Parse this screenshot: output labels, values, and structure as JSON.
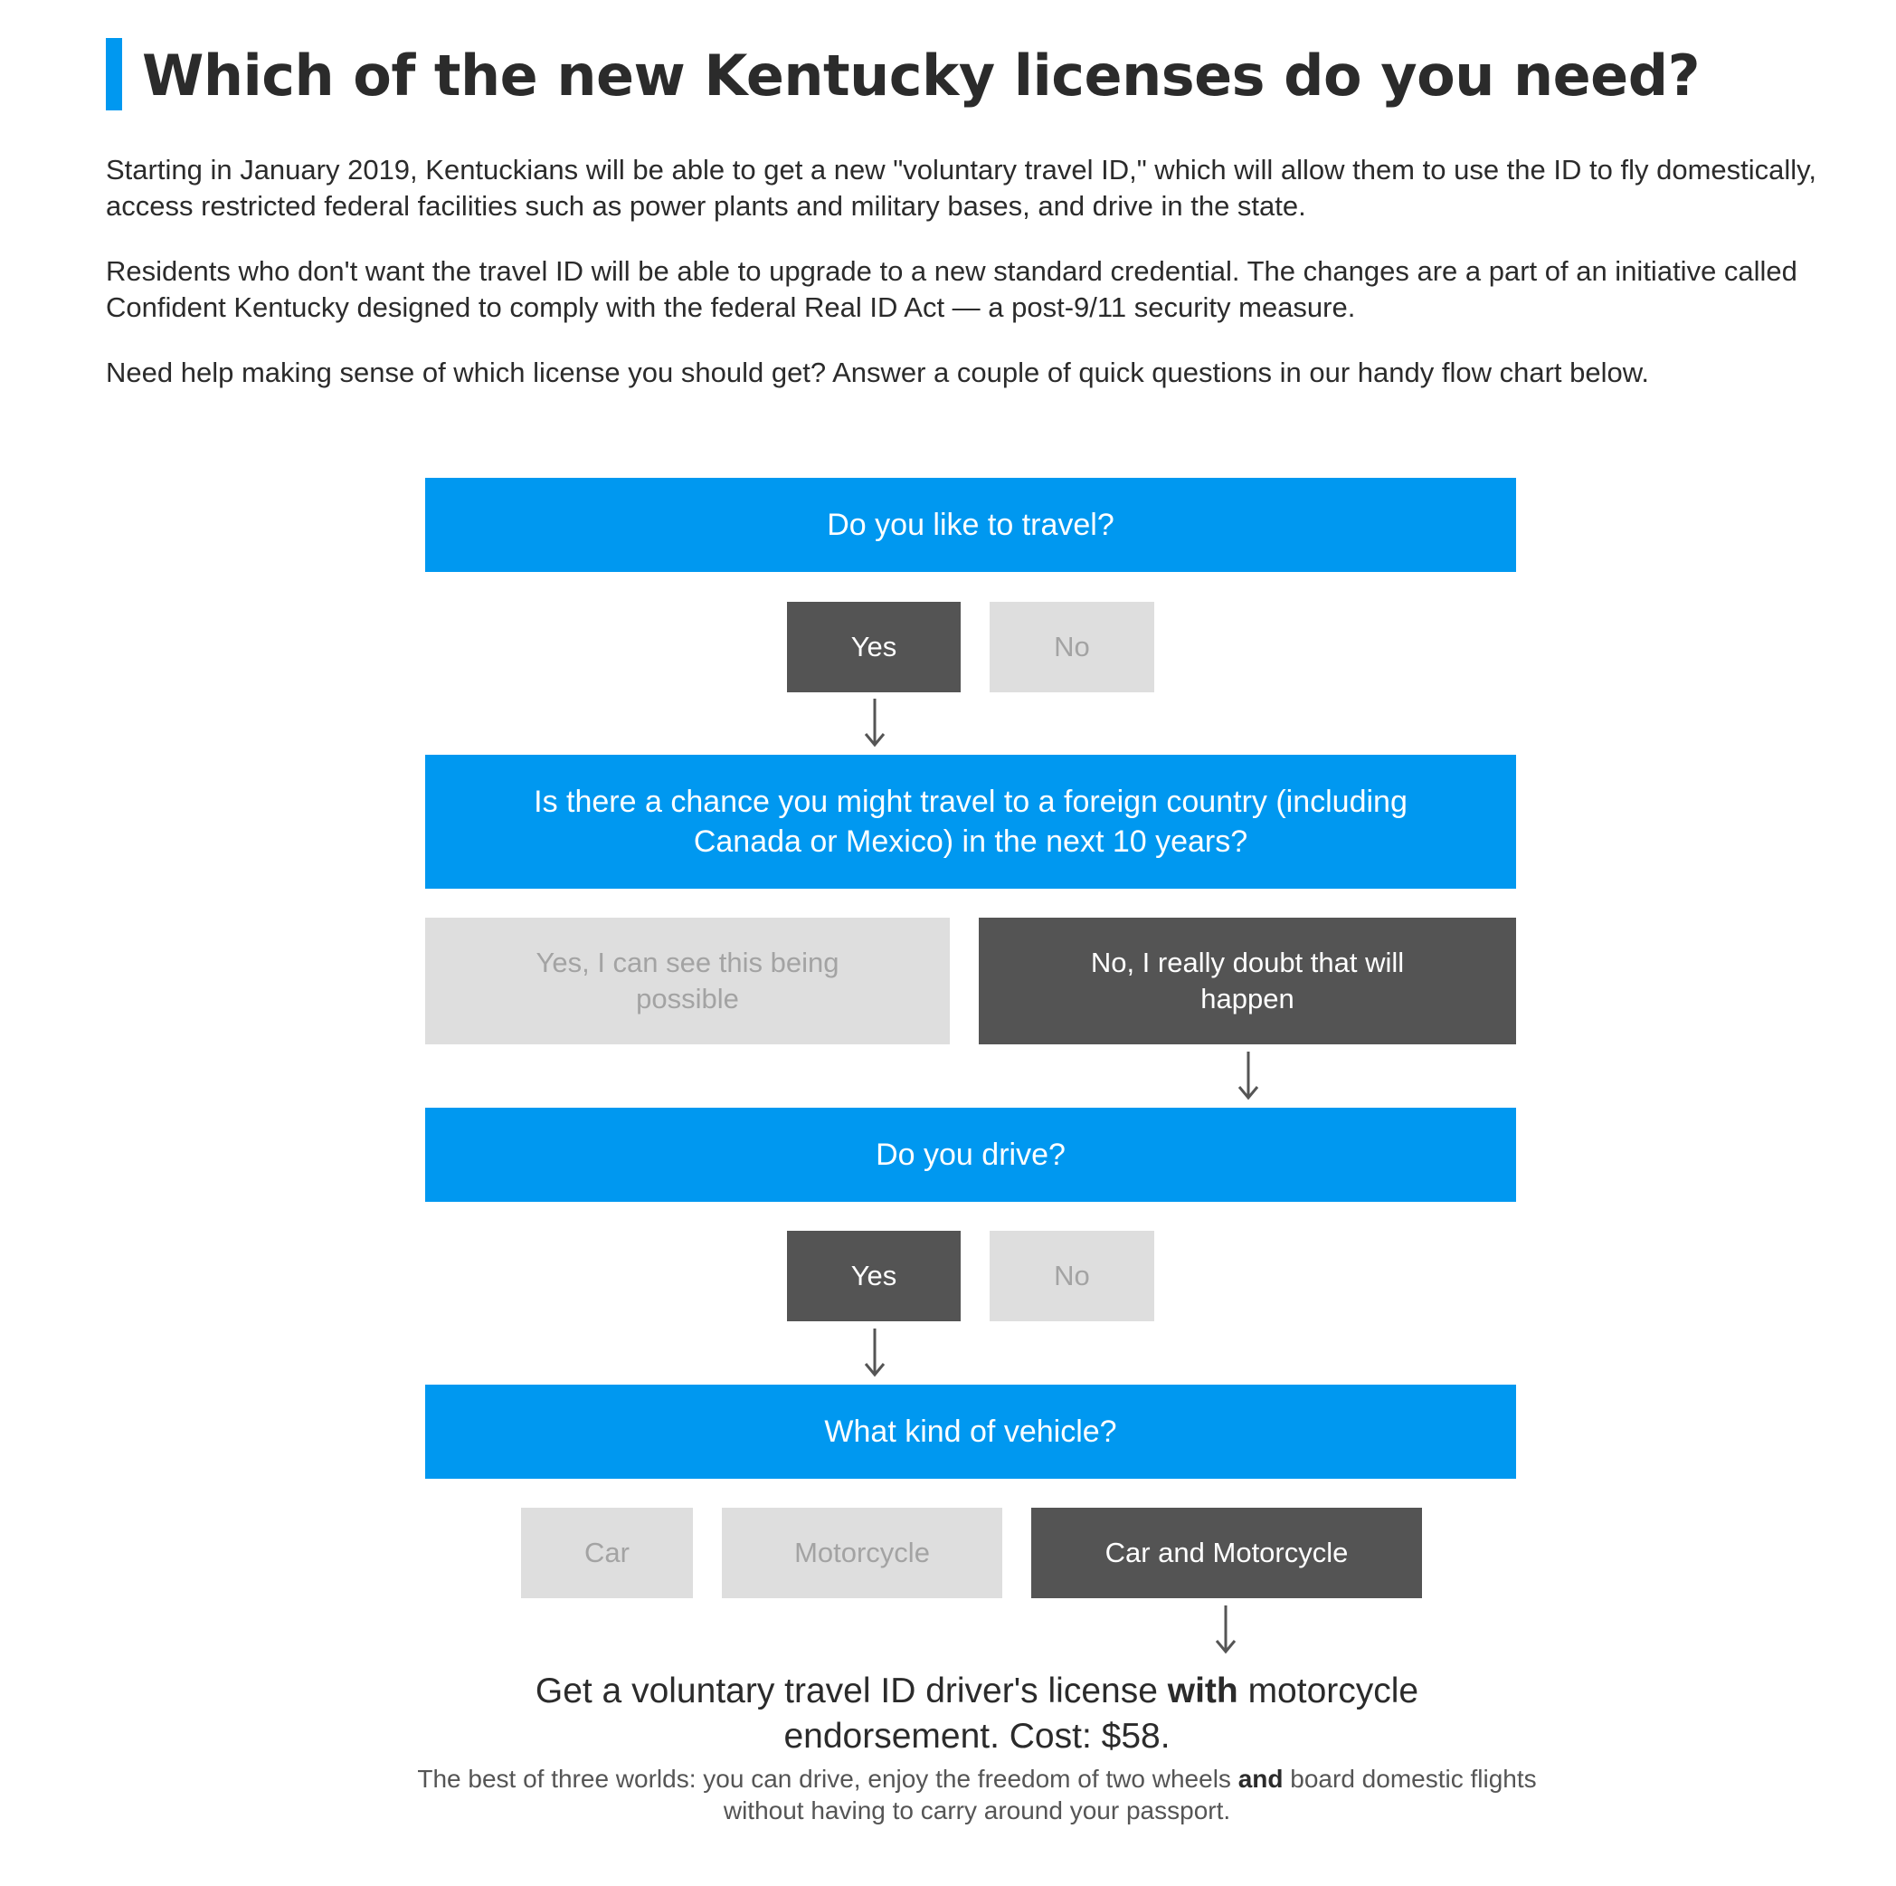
{
  "header": {
    "title": "Which of the new Kentucky licenses do you need?"
  },
  "intro": {
    "p1": "Starting in January 2019, Kentuckians will be able to get a new \"voluntary travel ID,\" which will allow them to use the ID to fly domestically, access restricted federal facilities such as power plants and military bases, and drive in the state.",
    "p2": "Residents who don't want the travel ID will be able to upgrade to a new standard credential. The changes are a part of an initiative called Confident Kentucky designed to comply with the federal Real ID Act — a post-9/11 security measure.",
    "p3": "Need help making sense of which license you should get? Answer a couple of quick questions in our handy flow chart below."
  },
  "flow": {
    "q1": {
      "question": "Do you like to travel?",
      "answers": [
        {
          "label": "Yes",
          "selected": true
        },
        {
          "label": "No",
          "selected": false
        }
      ]
    },
    "q2": {
      "question": "Is there a chance you might travel to a foreign country (including Canada or Mexico) in the next 10 years?",
      "answers": [
        {
          "label": "Yes, I can see this being possible",
          "selected": false
        },
        {
          "label": "No, I really doubt that will happen",
          "selected": true
        }
      ]
    },
    "q3": {
      "question": "Do you drive?",
      "answers": [
        {
          "label": "Yes",
          "selected": true
        },
        {
          "label": "No",
          "selected": false
        }
      ]
    },
    "q4": {
      "question": "What kind of vehicle?",
      "answers": [
        {
          "label": "Car",
          "selected": false
        },
        {
          "label": "Motorcycle",
          "selected": false
        },
        {
          "label": "Car and Motorcycle",
          "selected": true
        }
      ]
    }
  },
  "result": {
    "line_part1": "Get a voluntary travel ID driver's license ",
    "line_bold": "with",
    "line_part2": " motorcycle endorsement. Cost: $58.",
    "sub_part1": "The best of three worlds: you can drive, enjoy the freedom of two wheels ",
    "sub_bold": "and",
    "sub_part2": " board domestic flights without having to carry around your passport."
  },
  "colors": {
    "accent": "#0098f0",
    "selected": "#545454",
    "unselected": "#dedede",
    "text": "#2b2b2b"
  }
}
